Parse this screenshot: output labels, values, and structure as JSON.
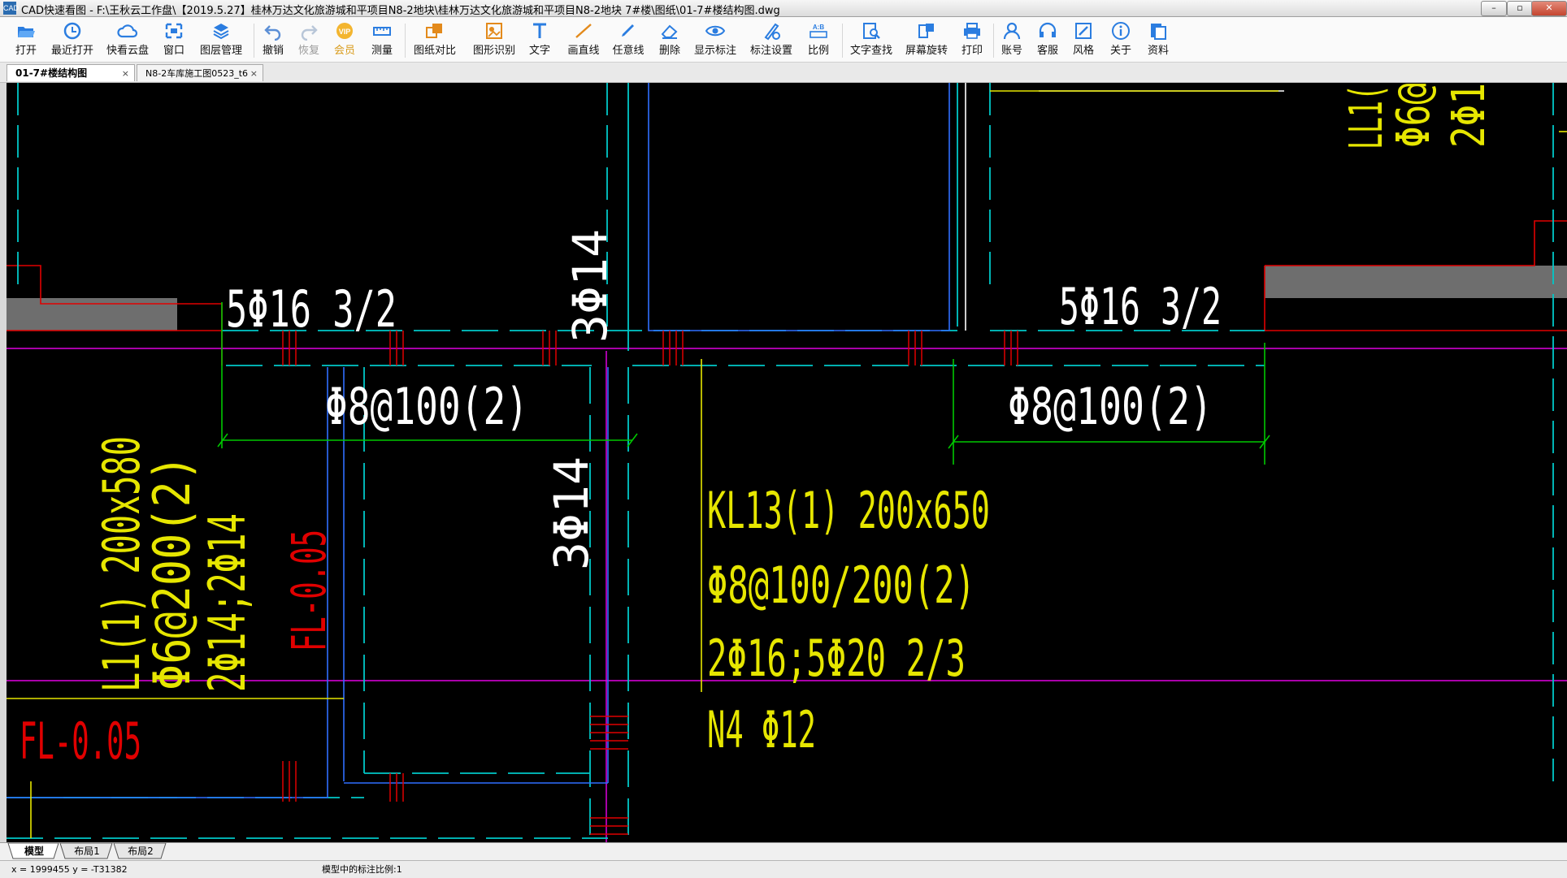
{
  "window": {
    "title": "CAD快速看图 - F:\\王秋云工作盘\\【2019.5.27】桂林万达文化旅游城和平项目N8-2地块\\桂林万达文化旅游城和平项目N8-2地块 7#楼\\图纸\\01-7#楼结构图.dwg",
    "app_icon_text": "CAD",
    "controls": {
      "minimize": "–",
      "maximize": "▫",
      "close": "✕"
    }
  },
  "toolbar": [
    {
      "label": "打开",
      "icon": "folder-open-icon"
    },
    {
      "label": "最近打开",
      "icon": "clock-icon"
    },
    {
      "label": "快看云盘",
      "icon": "cloud-icon"
    },
    {
      "label": "窗口",
      "icon": "window-icon"
    },
    {
      "label": "图层管理",
      "icon": "layers-icon"
    },
    {
      "label": "撤销",
      "icon": "undo-icon"
    },
    {
      "label": "恢复",
      "icon": "redo-icon"
    },
    {
      "label": "会员",
      "icon": "vip-icon"
    },
    {
      "label": "测量",
      "icon": "ruler-icon"
    },
    {
      "label": "图纸对比",
      "icon": "compare-icon"
    },
    {
      "label": "图形识别",
      "icon": "recognize-icon"
    },
    {
      "label": "文字",
      "icon": "text-icon"
    },
    {
      "label": "画直线",
      "icon": "line-icon"
    },
    {
      "label": "任意线",
      "icon": "pencil-icon"
    },
    {
      "label": "删除",
      "icon": "eraser-icon"
    },
    {
      "label": "显示标注",
      "icon": "eye-icon"
    },
    {
      "label": "标注设置",
      "icon": "annotation-settings-icon"
    },
    {
      "label": "比例",
      "icon": "scale-icon"
    },
    {
      "label": "文字查找",
      "icon": "text-search-icon"
    },
    {
      "label": "屏幕旋转",
      "icon": "rotate-screen-icon"
    },
    {
      "label": "打印",
      "icon": "printer-icon"
    },
    {
      "label": "账号",
      "icon": "user-icon"
    },
    {
      "label": "客服",
      "icon": "headset-icon"
    },
    {
      "label": "风格",
      "icon": "style-icon"
    },
    {
      "label": "关于",
      "icon": "info-icon"
    },
    {
      "label": "资料",
      "icon": "documents-icon"
    }
  ],
  "tabs": [
    {
      "label": "01-7#楼结构图",
      "active": true,
      "close": "×"
    },
    {
      "label": "N8-2车库施工图0523_t6",
      "active": false,
      "close": "×"
    }
  ],
  "drawing": {
    "texts": {
      "top_left_rebar": "5Φ16 3/2",
      "top_right_rebar": "5Φ16 3/2",
      "vertical_3phi14_upper": "3Φ14",
      "vertical_3phi14_lower": "3Φ14",
      "stirrup_left": "Φ8@100(2)",
      "stirrup_right": "Φ8@100(2)",
      "kl13_line1": "KL13(1) 200x650",
      "kl13_line2": "Φ8@100/200(2)",
      "kl13_line3": "2Φ16;5Φ20 2/3",
      "kl13_line4": "N4 Φ12",
      "l1_line1": "L1(1) 200x580",
      "l1_line2": "Φ6@200(2)",
      "l1_line3": "2Φ14;2Φ14",
      "fl_red_vertical": "FL-0.05",
      "fl_red_horizontal": "FL-0.05",
      "top_right_partial_1": "LL1(",
      "top_right_partial_2": "Φ6@",
      "top_right_partial_3": "2Φ1"
    },
    "colors": {
      "cyan": "#00c8c8",
      "yellow": "#e6e600",
      "red": "#e00000",
      "magenta": "#e000e0",
      "white": "#ffffff",
      "blue": "#2f6fff",
      "green": "#00c800",
      "gray_fill": "#707070"
    }
  },
  "layout_tabs": [
    {
      "label": "模型",
      "active": true
    },
    {
      "label": "布局1",
      "active": false
    },
    {
      "label": "布局2",
      "active": false
    }
  ],
  "status": {
    "coords": "x = 1999455  y = -T31382",
    "scale": "模型中的标注比例:1"
  }
}
